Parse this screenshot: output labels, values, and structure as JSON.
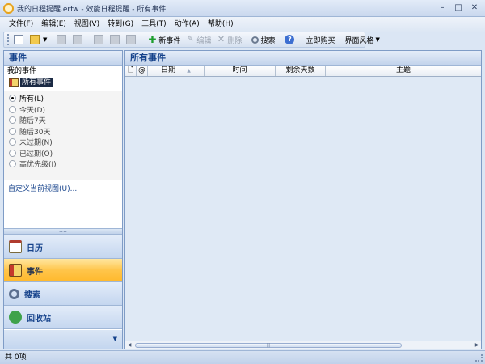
{
  "window": {
    "title": "我的日程提醒.erfw - 效能日程提醒 - 所有事件",
    "minimize": "–",
    "maximize": "□",
    "close": "✕"
  },
  "menu": [
    "文件(F)",
    "编辑(E)",
    "视图(V)",
    "转到(G)",
    "工具(T)",
    "动作(A)",
    "帮助(H)"
  ],
  "toolbar": {
    "new_event": "新事件",
    "edit": "编辑",
    "delete": "删除",
    "search": "搜索",
    "buy_now": "立即购买",
    "ui_style": "界面风格"
  },
  "left_panel": {
    "header": "事件",
    "section_title": "我的事件",
    "current_view": "所有事件",
    "filters": [
      {
        "label": "所有(L)",
        "checked": true
      },
      {
        "label": "今天(D)",
        "checked": false
      },
      {
        "label": "随后7天",
        "checked": false
      },
      {
        "label": "随后30天",
        "checked": false
      },
      {
        "label": "未过期(N)",
        "checked": false
      },
      {
        "label": "已过期(O)",
        "checked": false
      },
      {
        "label": "高优先级(I)",
        "checked": false
      }
    ],
    "customize_link": "自定义当前视图(U)...",
    "nav": {
      "calendar": "日历",
      "events": "事件",
      "search": "搜索",
      "recycle": "回收站"
    }
  },
  "main": {
    "header": "所有事件",
    "columns": {
      "date": "日期",
      "time": "时间",
      "days_left": "剩余天数",
      "subject": "主题"
    }
  },
  "status": {
    "text": "共 0项"
  }
}
